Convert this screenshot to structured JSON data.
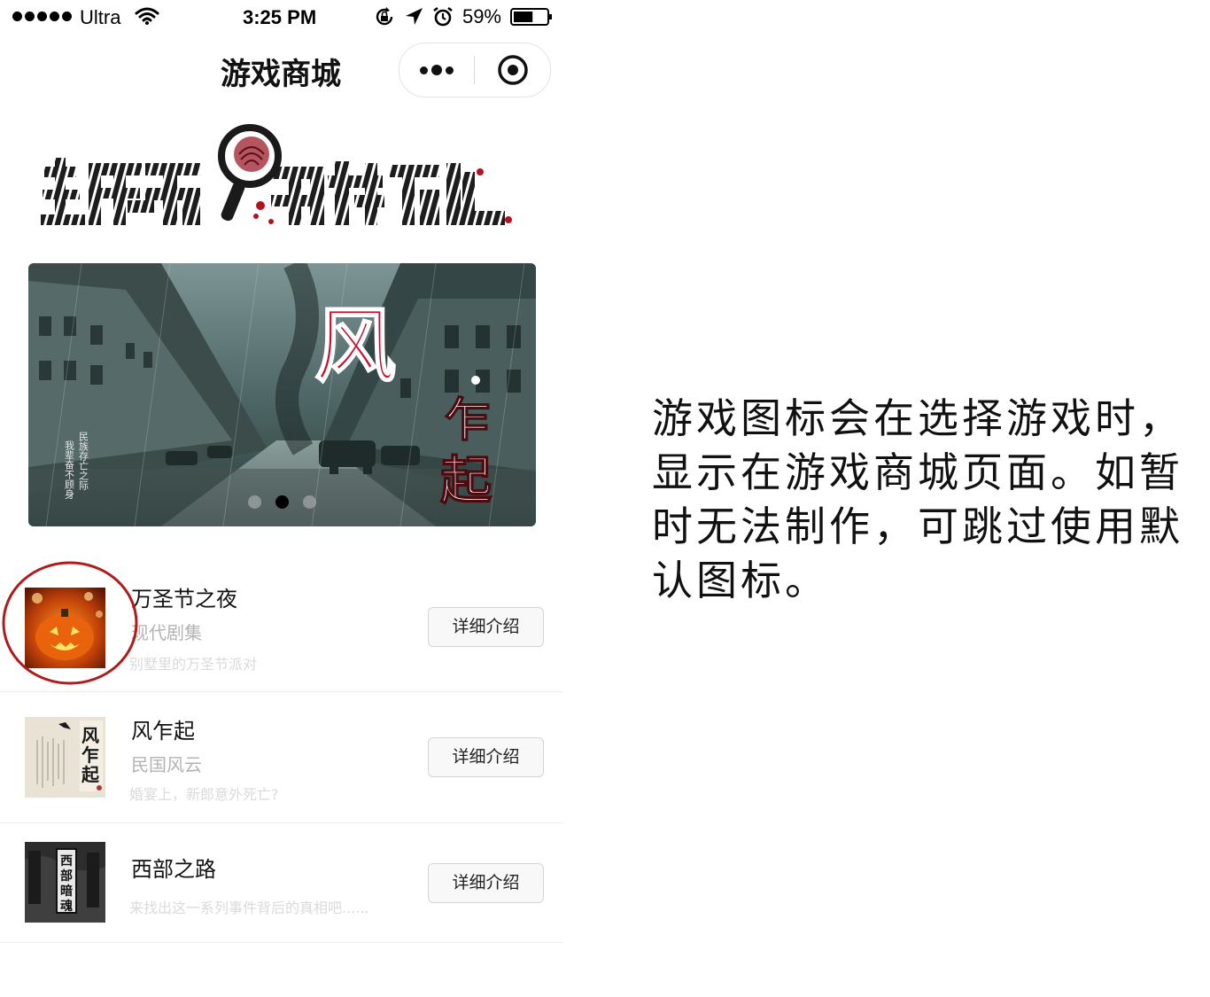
{
  "status_bar": {
    "carrier": "Ultra",
    "time": "3:25 PM",
    "battery": "59%",
    "battery_level": 0.59
  },
  "nav": {
    "title": "游戏商城"
  },
  "banner": {
    "slide_count": 3,
    "active_index": 1
  },
  "games": [
    {
      "title": "万圣节之夜",
      "genre": "现代剧集",
      "description": "别墅里的万圣节派对",
      "button": "详细介绍"
    },
    {
      "title": "风乍起",
      "genre": "民国风云",
      "description": "婚宴上，新郎意外死亡?",
      "button": "详细介绍"
    },
    {
      "title": "西部之路",
      "genre": "",
      "description": "来找出这一系列事件背后的真相吧......",
      "button": "详细介绍"
    }
  ],
  "annotation": "游戏图标会在选择游戏时，显示在游戏商城页面。如暂时无法制作，可跳过使用默认图标。",
  "colors": {
    "highlight": "#b01c1c",
    "title_red": "#c8102e"
  }
}
